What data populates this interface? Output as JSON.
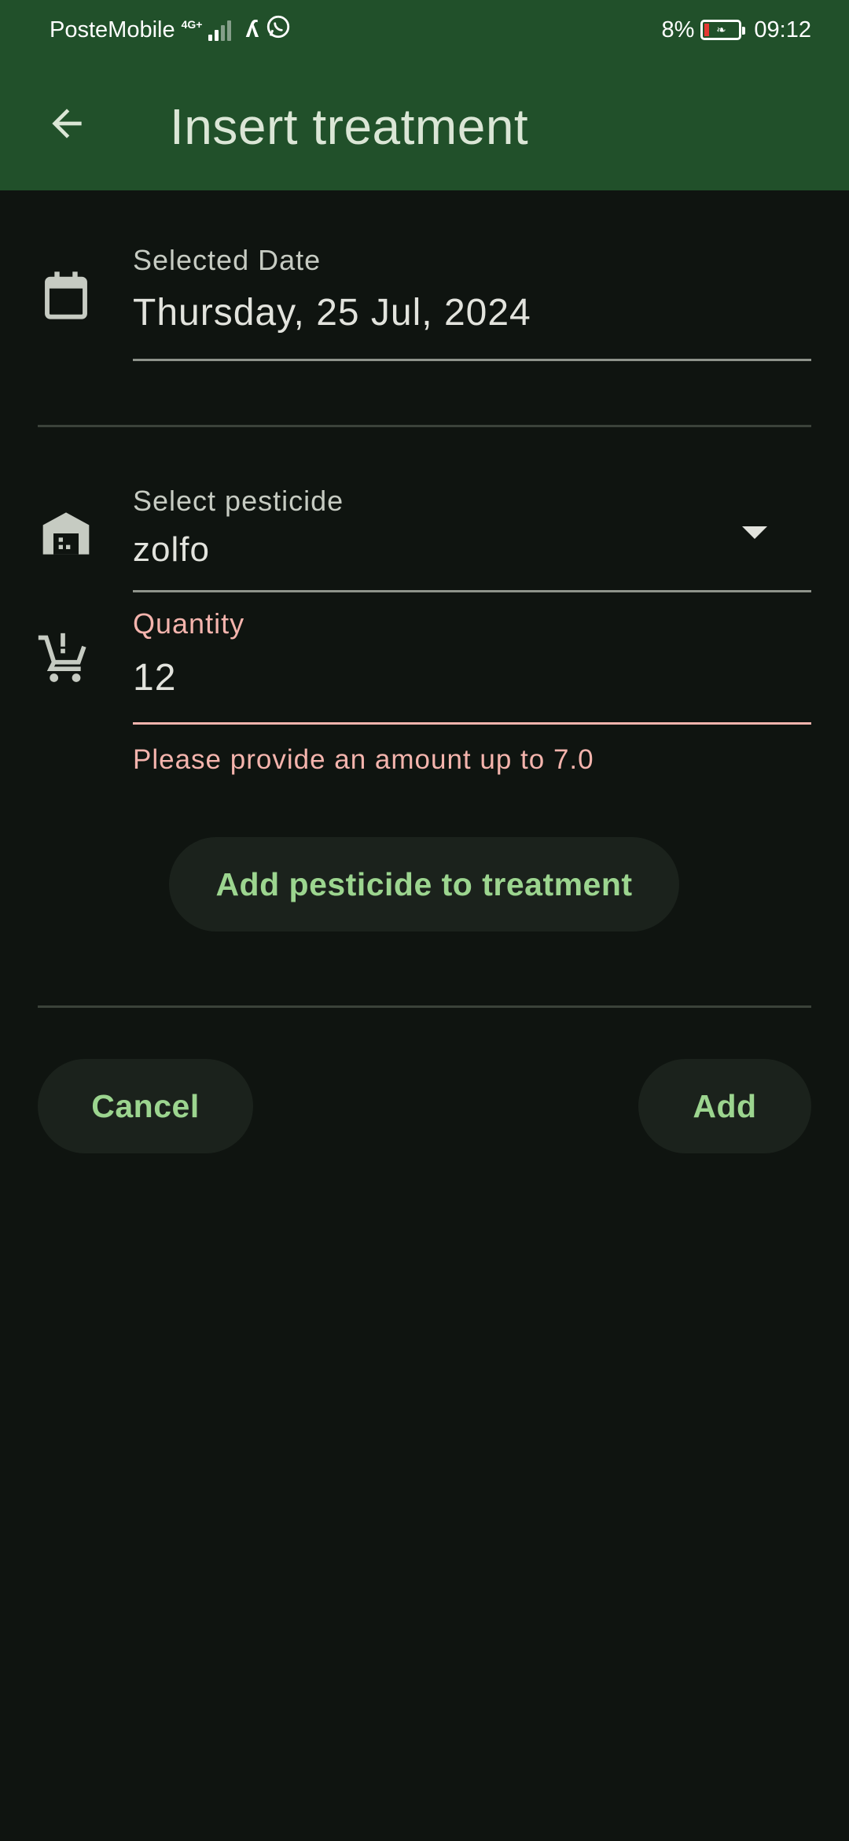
{
  "status_bar": {
    "carrier": "PosteMobile",
    "network": "4G+",
    "battery": "8%",
    "time": "09:12"
  },
  "app_bar": {
    "title": "Insert treatment"
  },
  "date_field": {
    "label": "Selected Date",
    "value": "Thursday, 25 Jul, 2024"
  },
  "pesticide_field": {
    "label": "Select pesticide",
    "value": "zolfo"
  },
  "quantity_field": {
    "label": "Quantity",
    "value": "12",
    "error": "Please provide an amount up to 7.0"
  },
  "buttons": {
    "add_pesticide": "Add pesticide to treatment",
    "cancel": "Cancel",
    "add": "Add"
  },
  "colors": {
    "app_bar": "#21502a",
    "background": "#0f1410",
    "accent": "#9cd58f",
    "error": "#f4b4ad"
  }
}
